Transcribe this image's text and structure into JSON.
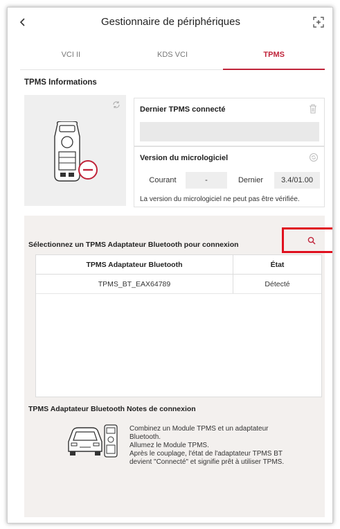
{
  "header": {
    "title": "Gestionnaire de périphériques",
    "back_icon": "chevron-left-icon",
    "expand_icon": "expand-icon"
  },
  "tabs": [
    {
      "label": "VCI II",
      "active": false
    },
    {
      "label": "KDS VCI",
      "active": false
    },
    {
      "label": "TPMS",
      "active": true
    }
  ],
  "info": {
    "section_title": "TPMS Informations",
    "last_label": "Dernier TPMS connecté",
    "last_value": "",
    "firmware_label": "Version du micrologiciel",
    "current_label": "Courant",
    "current_value": "-",
    "latest_label": "Dernier",
    "latest_value": "3.4/01.00",
    "note": "La version du micrologiciel ne peut pas être vérifiée."
  },
  "adapter": {
    "select_title": "Sélectionnez un TPMS Adaptateur Bluetooth pour connexion",
    "columns": [
      "TPMS Adaptateur Bluetooth",
      "État"
    ],
    "rows": [
      {
        "name": "TPMS_BT_EAX64789",
        "status": "Détecté"
      }
    ]
  },
  "notes": {
    "title": "TPMS Adaptateur Bluetooth Notes de connexion",
    "text": "Combinez un Module TPMS et un adaptateur\nBluetooth.\nAllumez le Module TPMS.\nAprès le couplage, l'état de l'adaptateur TPMS BT\ndevient \"Connecté\" et signifie prêt à utiliser TPMS."
  },
  "colors": {
    "accent": "#c0243a",
    "highlight": "#e0111f"
  }
}
